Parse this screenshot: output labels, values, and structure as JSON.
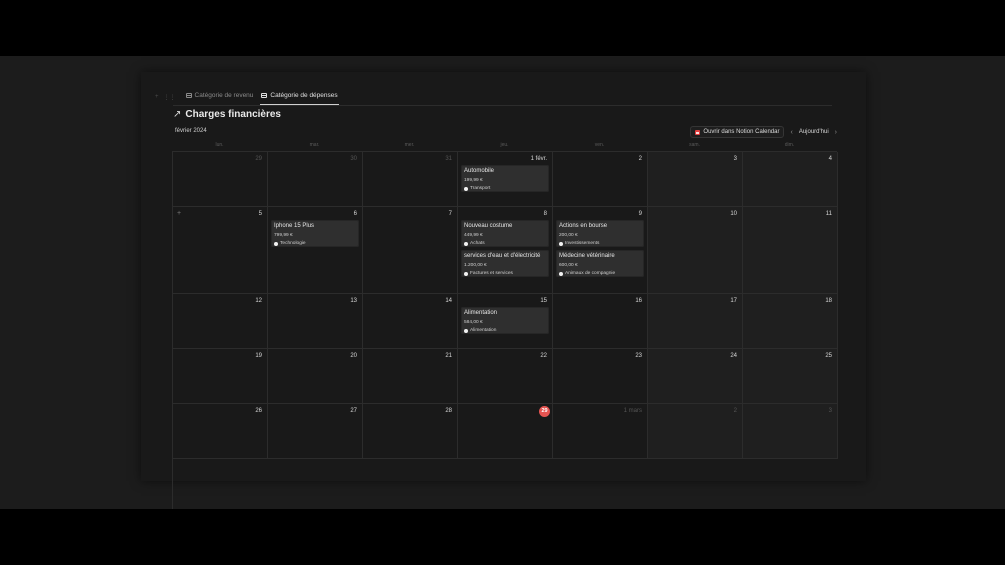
{
  "tabs": [
    {
      "label": "Catégorie de revenu",
      "active": false
    },
    {
      "label": "Catégorie de dépenses",
      "active": true
    }
  ],
  "title": "Charges financières",
  "month_label": "février 2024",
  "toolbar": {
    "open_label": "Ouvrir dans Notion Calendar",
    "today_label": "Aujourd'hui"
  },
  "weekdays": [
    "lun.",
    "mar.",
    "mer.",
    "jeu.",
    "ven.",
    "sam.",
    "dim."
  ],
  "weeks": [
    [
      {
        "day": "29",
        "out": true
      },
      {
        "day": "30",
        "out": true
      },
      {
        "day": "31",
        "out": true
      },
      {
        "day": "1 févr.",
        "events": [
          {
            "title": "Automobile",
            "amount": "199,99 €",
            "category": "Transport"
          }
        ]
      },
      {
        "day": "2"
      },
      {
        "day": "3"
      },
      {
        "day": "4"
      }
    ],
    [
      {
        "day": "5",
        "add": true
      },
      {
        "day": "6",
        "events": [
          {
            "title": "Iphone 15 Plus",
            "amount": "799,99 €",
            "category": "Technologie"
          }
        ]
      },
      {
        "day": "7"
      },
      {
        "day": "8",
        "events": [
          {
            "title": "Nouveau costume",
            "amount": "449,99 €",
            "category": "Achats"
          },
          {
            "title": "services d'eau et d'électricité",
            "amount": "1.200,00 €",
            "category": "Factures et services"
          }
        ]
      },
      {
        "day": "9",
        "events": [
          {
            "title": "Actions en bourse",
            "amount": "200,00 €",
            "category": "Investissements"
          },
          {
            "title": "Médecine vétérinaire",
            "amount": "600,00 €",
            "category": "Animaux de compagnie"
          }
        ]
      },
      {
        "day": "10"
      },
      {
        "day": "11"
      }
    ],
    [
      {
        "day": "12"
      },
      {
        "day": "13"
      },
      {
        "day": "14"
      },
      {
        "day": "15",
        "events": [
          {
            "title": "Alimentation",
            "amount": "584,00 €",
            "category": "Alimentation"
          }
        ]
      },
      {
        "day": "16"
      },
      {
        "day": "17"
      },
      {
        "day": "18"
      }
    ],
    [
      {
        "day": "19"
      },
      {
        "day": "20"
      },
      {
        "day": "21"
      },
      {
        "day": "22"
      },
      {
        "day": "23"
      },
      {
        "day": "24"
      },
      {
        "day": "25"
      }
    ],
    [
      {
        "day": "26"
      },
      {
        "day": "27"
      },
      {
        "day": "28"
      },
      {
        "day": "29",
        "today": true
      },
      {
        "day": "1 mars",
        "out": true
      },
      {
        "day": "2",
        "out": true
      },
      {
        "day": "3",
        "out": true
      }
    ]
  ],
  "colors": {
    "today_badge": "#e55451",
    "calendar_icon": "#e03e3e"
  }
}
